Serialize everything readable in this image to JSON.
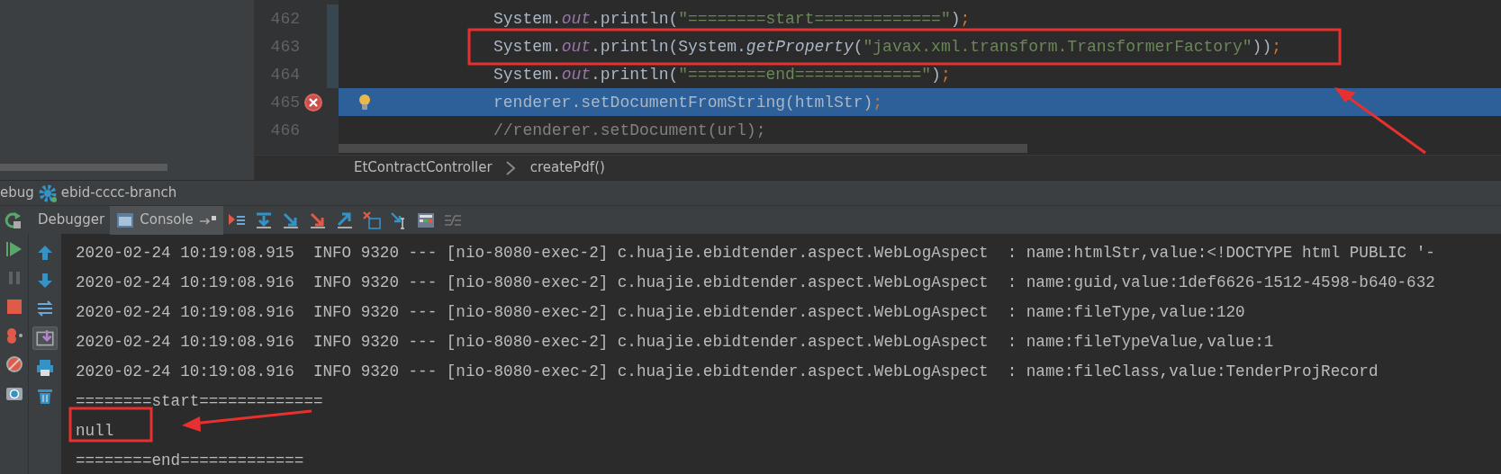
{
  "editor": {
    "lines": [
      {
        "number": "462",
        "breakpoint": false,
        "current": false,
        "tokens": [
          {
            "kind": "plain",
            "text": "System."
          },
          {
            "kind": "field",
            "text": "out"
          },
          {
            "kind": "plain",
            "text": ".println("
          },
          {
            "kind": "string",
            "text": "\"========start=============\""
          },
          {
            "kind": "plain",
            "text": ")"
          },
          {
            "kind": "punct",
            "text": ";"
          }
        ]
      },
      {
        "number": "463",
        "breakpoint": false,
        "current": false,
        "tokens": [
          {
            "kind": "plain",
            "text": "System."
          },
          {
            "kind": "field",
            "text": "out"
          },
          {
            "kind": "plain",
            "text": ".println(System."
          },
          {
            "kind": "method",
            "text": "getProperty"
          },
          {
            "kind": "plain",
            "text": "("
          },
          {
            "kind": "string",
            "text": "\"javax.xml.transform.TransformerFactory\""
          },
          {
            "kind": "plain",
            "text": "))"
          },
          {
            "kind": "punct",
            "text": ";"
          }
        ]
      },
      {
        "number": "464",
        "breakpoint": false,
        "current": false,
        "tokens": [
          {
            "kind": "plain",
            "text": "System."
          },
          {
            "kind": "field",
            "text": "out"
          },
          {
            "kind": "plain",
            "text": ".println("
          },
          {
            "kind": "string",
            "text": "\"========end=============\""
          },
          {
            "kind": "plain",
            "text": ")"
          },
          {
            "kind": "punct",
            "text": ";"
          }
        ]
      },
      {
        "number": "465",
        "breakpoint": true,
        "current": true,
        "tokens": [
          {
            "kind": "plain",
            "text": "renderer.setDocumentFromString(htmlStr)"
          },
          {
            "kind": "punct",
            "text": ";"
          }
        ]
      },
      {
        "number": "466",
        "breakpoint": false,
        "current": false,
        "tokens": [
          {
            "kind": "comment",
            "text": "//renderer.setDocument(url);"
          }
        ]
      }
    ]
  },
  "breadcrumbs": [
    "EtContractController",
    "createPdf()"
  ],
  "debug_panel": {
    "title": "ebug",
    "config": "ebid-cccc-branch",
    "tabs": [
      {
        "label": "Debugger",
        "selected": false
      },
      {
        "label": "Console",
        "selected": true
      }
    ]
  },
  "console": {
    "lines": [
      "2020-02-24 10:19:08.915  INFO 9320 --- [nio-8080-exec-2] c.huajie.ebidtender.aspect.WebLogAspect  : name:htmlStr,value:<!DOCTYPE html PUBLIC '-",
      "2020-02-24 10:19:08.916  INFO 9320 --- [nio-8080-exec-2] c.huajie.ebidtender.aspect.WebLogAspect  : name:guid,value:1def6626-1512-4598-b640-632",
      "2020-02-24 10:19:08.916  INFO 9320 --- [nio-8080-exec-2] c.huajie.ebidtender.aspect.WebLogAspect  : name:fileType,value:120",
      "2020-02-24 10:19:08.916  INFO 9320 --- [nio-8080-exec-2] c.huajie.ebidtender.aspect.WebLogAspect  : name:fileTypeValue,value:1",
      "2020-02-24 10:19:08.916  INFO 9320 --- [nio-8080-exec-2] c.huajie.ebidtender.aspect.WebLogAspect  : name:fileClass,value:TenderProjRecord",
      "========start=============",
      "null",
      "========end============="
    ]
  }
}
